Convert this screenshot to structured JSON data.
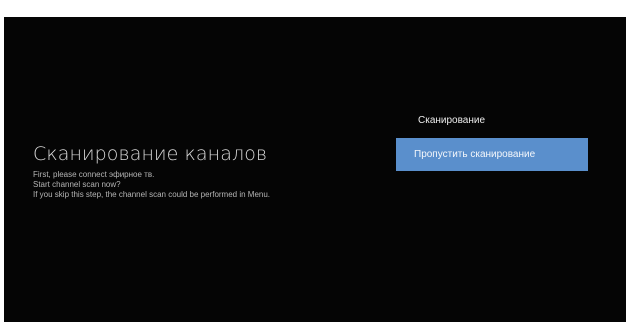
{
  "scan": {
    "title": "Сканирование каналов",
    "description": [
      "First, please connect эфирное тв.",
      "Start channel scan now?",
      " If you skip this step, the channel scan could be performed in Menu."
    ]
  },
  "options": {
    "scan_label": "Сканирование",
    "skip_label": "Пропустить сканирование"
  },
  "colors": {
    "background": "#050505",
    "accent": "#5a8fcc"
  }
}
